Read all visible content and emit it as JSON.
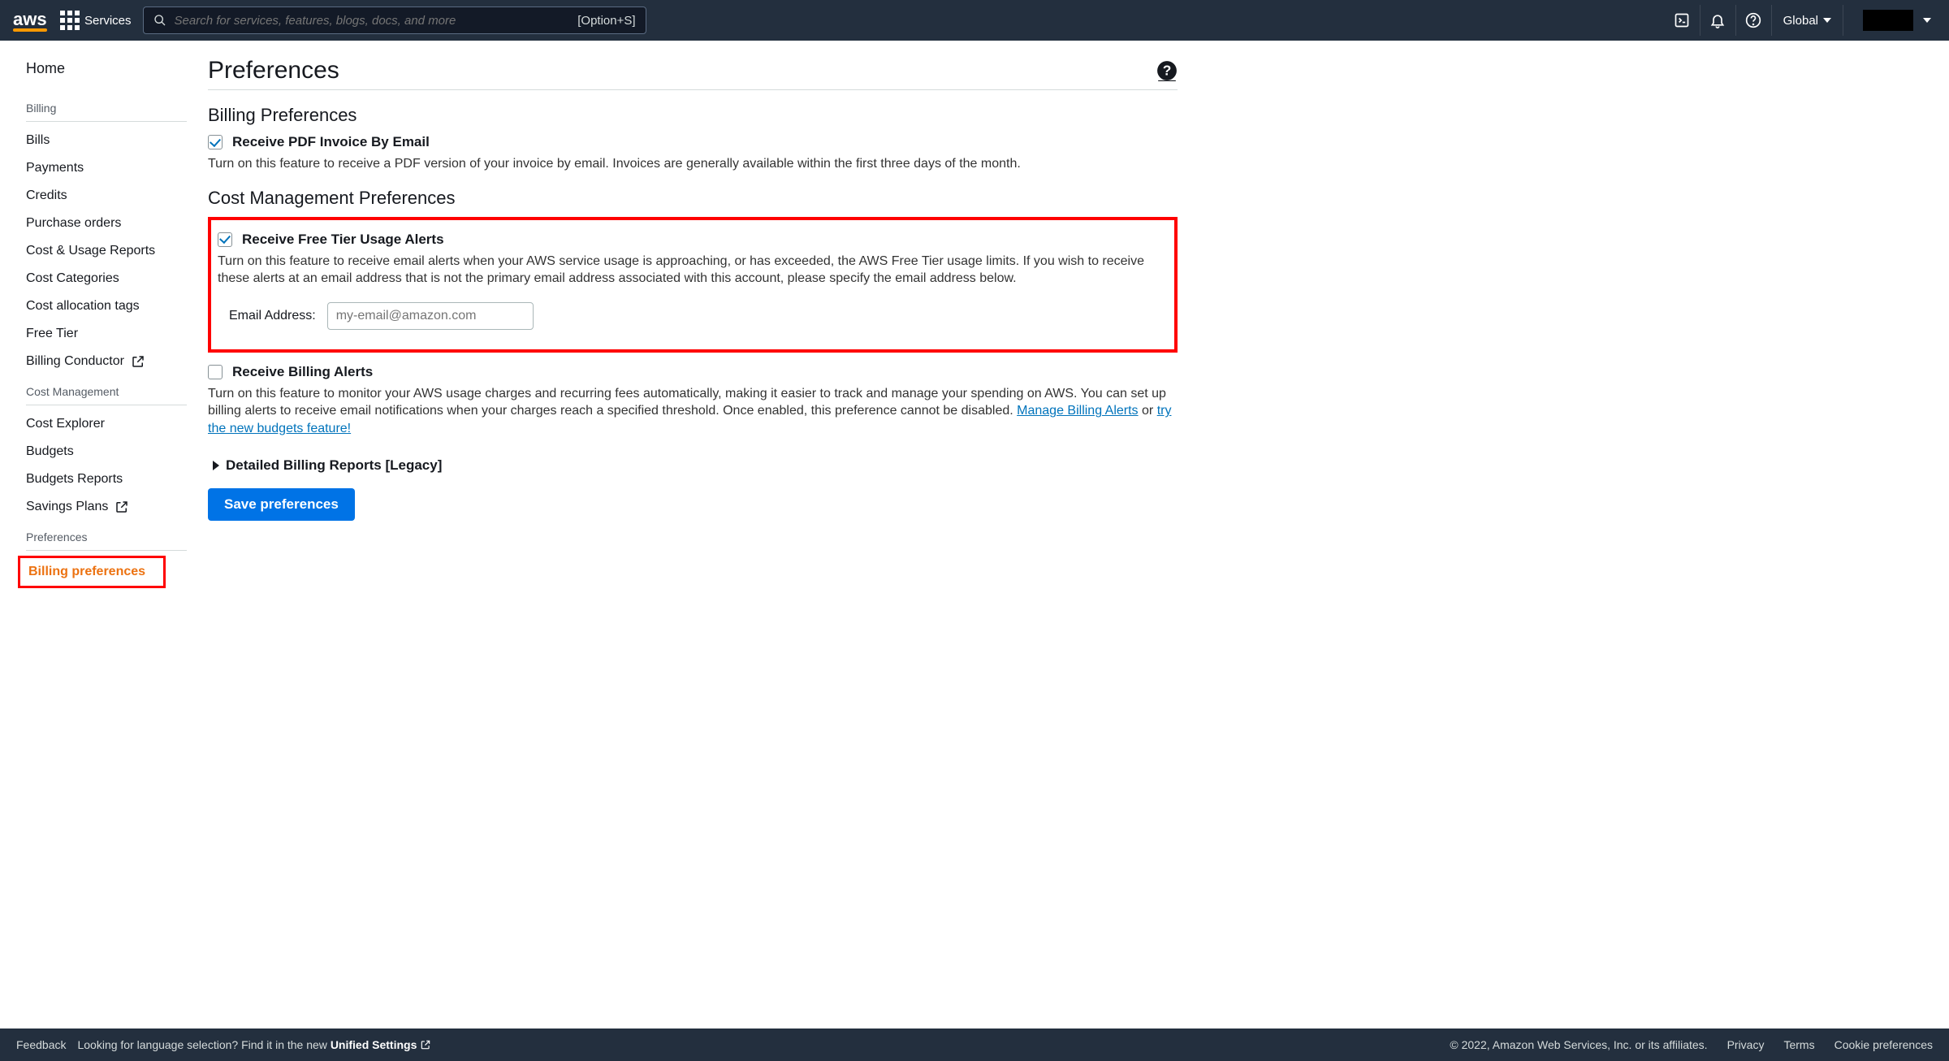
{
  "topnav": {
    "logo": "aws",
    "services": "Services",
    "search_placeholder": "Search for services, features, blogs, docs, and more",
    "search_shortcut": "[Option+S]",
    "region": "Global"
  },
  "sidebar": {
    "home": "Home",
    "sections": {
      "billing": {
        "title": "Billing",
        "items": [
          "Bills",
          "Payments",
          "Credits",
          "Purchase orders",
          "Cost & Usage Reports",
          "Cost Categories",
          "Cost allocation tags",
          "Free Tier",
          "Billing Conductor"
        ]
      },
      "cost_management": {
        "title": "Cost Management",
        "items": [
          "Cost Explorer",
          "Budgets",
          "Budgets Reports",
          "Savings Plans"
        ]
      },
      "preferences": {
        "title": "Preferences",
        "items": [
          "Billing preferences"
        ]
      }
    }
  },
  "main": {
    "title": "Preferences",
    "billing_section": "Billing Preferences",
    "pdf_invoice": {
      "label": "Receive PDF Invoice By Email",
      "desc": "Turn on this feature to receive a PDF version of your invoice by email. Invoices are generally available within the first three days of the month."
    },
    "cost_section": "Cost Management Preferences",
    "free_tier": {
      "label": "Receive Free Tier Usage Alerts",
      "desc": "Turn on this feature to receive email alerts when your AWS service usage is approaching, or has exceeded, the AWS Free Tier usage limits. If you wish to receive these alerts at an email address that is not the primary email address associated with this account, please specify the email address below.",
      "email_label": "Email Address:",
      "email_placeholder": "my-email@amazon.com"
    },
    "billing_alerts": {
      "label": "Receive Billing Alerts",
      "desc_pre": "Turn on this feature to monitor your AWS usage charges and recurring fees automatically, making it easier to track and manage your spending on AWS. You can set up billing alerts to receive email notifications when your charges reach a specified threshold. Once enabled, this preference cannot be disabled. ",
      "link1": "Manage Billing Alerts",
      "or": " or ",
      "link2": "try the new budgets feature!"
    },
    "detailed": "Detailed Billing Reports [Legacy]",
    "save": "Save preferences"
  },
  "footer": {
    "feedback": "Feedback",
    "lang_prompt": "Looking for language selection? Find it in the new ",
    "unified": "Unified Settings",
    "copyright": "© 2022, Amazon Web Services, Inc. or its affiliates.",
    "privacy": "Privacy",
    "terms": "Terms",
    "cookies": "Cookie preferences"
  }
}
